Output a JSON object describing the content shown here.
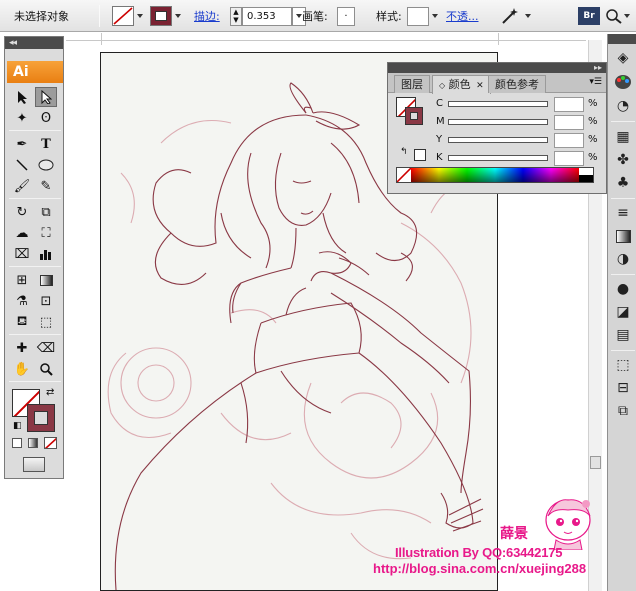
{
  "control_bar": {
    "selection_status": "未选择对象",
    "stroke_label": "描边:",
    "stroke_value": "0.353",
    "brush_label": "画笔:",
    "brush_value": "·",
    "style_label": "样式:",
    "opacity_label": "不透..."
  },
  "toolbox": {
    "logo": "Ai"
  },
  "color_panel": {
    "tabs": [
      "图层",
      "颜色",
      "颜色参考"
    ],
    "channels": [
      {
        "label": "C",
        "value": ""
      },
      {
        "label": "M",
        "value": ""
      },
      {
        "label": "Y",
        "value": ""
      },
      {
        "label": "K",
        "value": ""
      }
    ],
    "percent_sign": "%"
  },
  "watermark": {
    "name": "薛景",
    "credit": "Illustration By QQ:63442175",
    "url": "http://blog.sina.com.cn/xuejing288"
  },
  "colors": {
    "sketch_line": "#8a3845",
    "pencil_line": "#d8a0a8",
    "accent_orange": "#f08a1d",
    "watermark_pink": "#e8198a"
  }
}
